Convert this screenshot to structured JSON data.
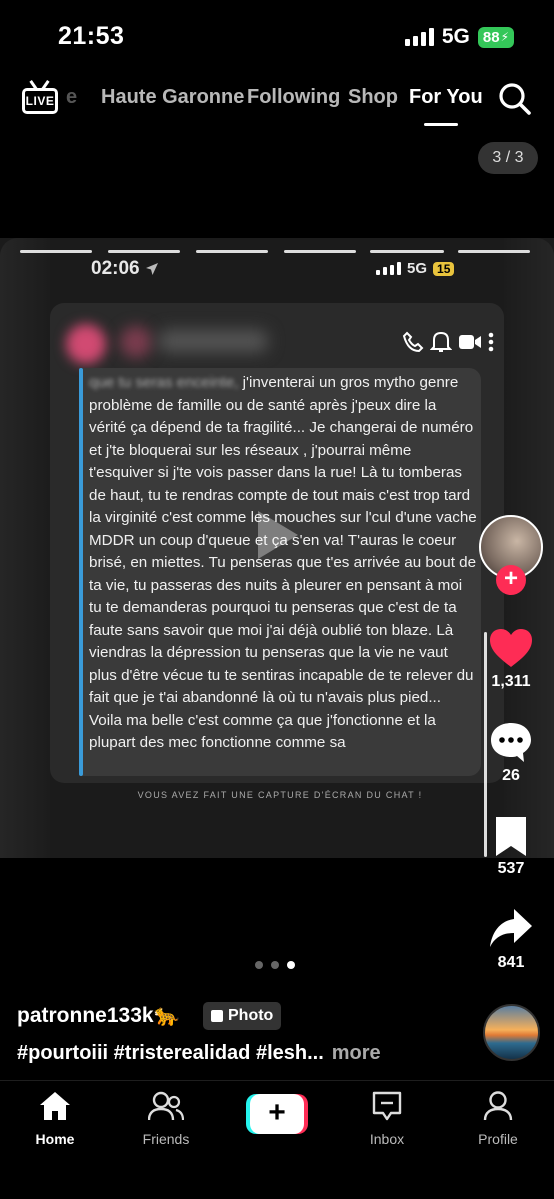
{
  "status_bar": {
    "time": "21:53",
    "network": "5G",
    "battery": "88"
  },
  "top_nav": {
    "live_label": "LIVE",
    "faded_tab": "e",
    "tabs": [
      "Haute Garonne",
      "Following",
      "Shop",
      "For You"
    ],
    "active_tab": "For You"
  },
  "post_counter": "3 / 3",
  "screenshot_inner": {
    "time": "02:06",
    "network": "5G",
    "battery": "15",
    "message_blurred_prefix": "que tu seras enceinte,",
    "message": " j'inventerai un gros mytho genre problème de famille ou de santé après j'peux dire la vérité ça dépend de ta fragilité... Je changerai de numéro et j'te bloquerai sur les réseaux , j'pourrai même t'esquiver si j'te vois passer dans la rue! Là tu tomberas de haut, tu te rendras compte de tout mais c'est trop tard la virginité c'est comme les mouches sur l'cul d'une vache MDDR un coup d'queue et ça s'en va! T'auras le coeur brisé, en miettes. Tu penseras que t'es arrivée au bout de ta vie, tu passeras des nuits à pleurer en pensant à moi tu te demanderas pourquoi tu penseras que c'est de ta faute sans savoir que moi j'ai déjà oublié ton blaze. Là viendras la dépression tu penseras que la vie ne vaut plus d'être vécue tu te sentiras incapable de te relever du fait que je t'ai abandonné là où tu n'avais plus pied... Voila ma belle c'est comme ça que j'fonctionne et la plupart des mec fonctionne comme sa",
    "screenshot_notice": "VOUS AVEZ FAIT UNE CAPTURE D'ÉCRAN DU CHAT !"
  },
  "actions": {
    "likes": "1,311",
    "comments": "26",
    "saves": "537",
    "shares": "841"
  },
  "slide_dots": {
    "total": 3,
    "active": 3
  },
  "author": {
    "username": "patronne133k🐆",
    "badge": "Photo"
  },
  "caption": {
    "text": "#pourtoiii #tristerealidad #lesh...",
    "more": "more"
  },
  "bottom_nav": {
    "home": "Home",
    "friends": "Friends",
    "inbox": "Inbox",
    "profile": "Profile"
  },
  "colors": {
    "accent": "#fe2c55",
    "message_bar": "#3a9bd9",
    "battery": "#34c759"
  }
}
